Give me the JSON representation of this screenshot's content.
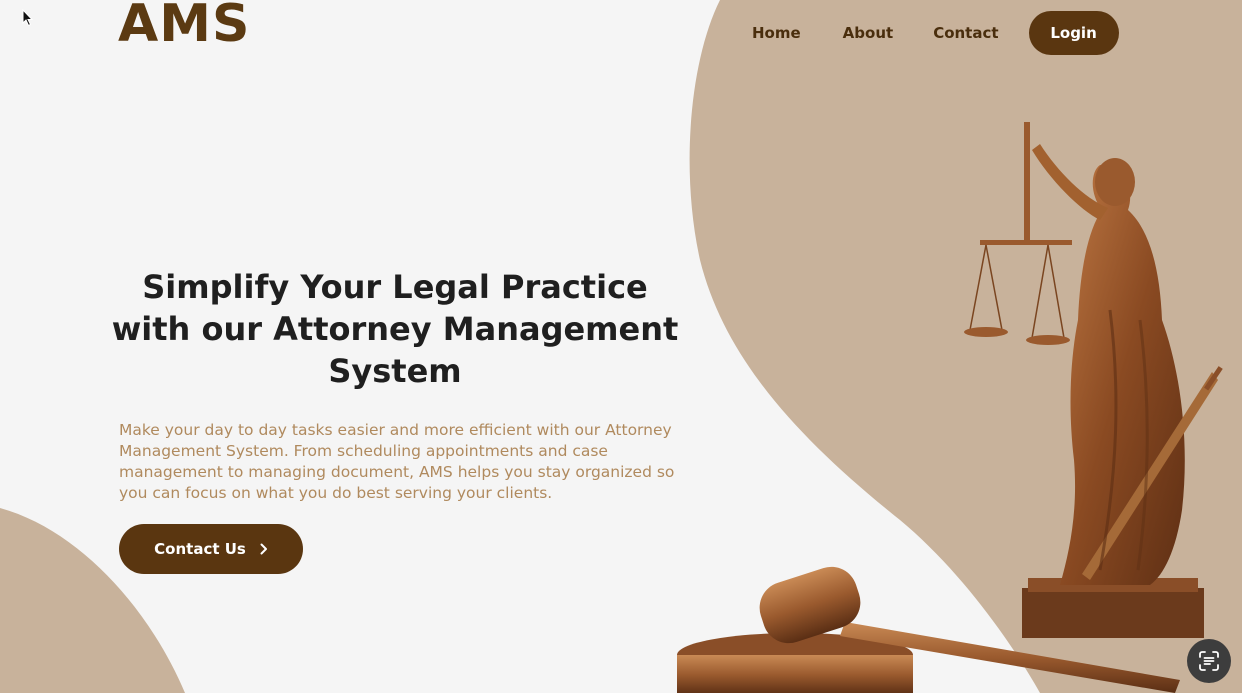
{
  "brand": {
    "logo_text": "AMS"
  },
  "nav": {
    "items": [
      {
        "label": "Home"
      },
      {
        "label": "About"
      },
      {
        "label": "Contact"
      }
    ],
    "login_label": "Login"
  },
  "hero": {
    "title_lines": [
      "Simplify Your Legal Practice",
      "with our Attorney Management",
      "System"
    ],
    "description": "Make your day to day tasks easier and more efficient with our Attorney Management System. From scheduling appointments and case management to managing document, AMS helps you stay organized so you can focus on what you do best serving your clients.",
    "cta_label": "Contact Us"
  },
  "icons": {
    "cta": "chevron-right-icon",
    "floating": "scan-text-icon",
    "cursor": "mouse-pointer-icon"
  },
  "colors": {
    "background": "#f5f5f5",
    "accent_shape": "#c8b29b",
    "brand_brown": "#5a3610",
    "description_text": "#b08a5e",
    "title_text": "#1f1f1f",
    "bronze": "#9a5a2e"
  }
}
